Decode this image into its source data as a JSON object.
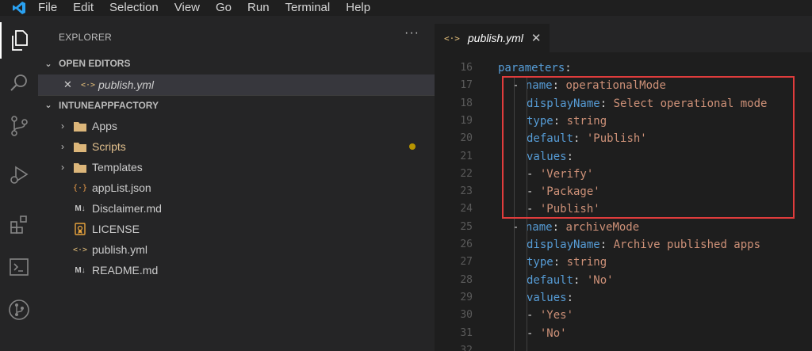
{
  "menu": [
    "File",
    "Edit",
    "Selection",
    "View",
    "Go",
    "Run",
    "Terminal",
    "Help"
  ],
  "activity_bar": [
    {
      "name": "explorer-icon",
      "active": true
    },
    {
      "name": "search-icon",
      "active": false
    },
    {
      "name": "source-control-icon",
      "active": false
    },
    {
      "name": "run-debug-icon",
      "active": false
    },
    {
      "name": "extensions-icon",
      "active": false
    },
    {
      "name": "terminal-icon",
      "active": false
    },
    {
      "name": "git-icon",
      "active": false
    }
  ],
  "sidebar": {
    "title": "EXPLORER",
    "more": "···",
    "open_editors_label": "OPEN EDITORS",
    "open_editor_close": "✕",
    "open_editor_file": "publish.yml",
    "project_label": "INTUNEAPPFACTORY",
    "items": [
      {
        "label": "Apps",
        "type": "folder"
      },
      {
        "label": "Scripts",
        "type": "folder",
        "modified": true
      },
      {
        "label": "Templates",
        "type": "folder"
      },
      {
        "label": "appList.json",
        "type": "json"
      },
      {
        "label": "Disclaimer.md",
        "type": "md"
      },
      {
        "label": "LICENSE",
        "type": "license"
      },
      {
        "label": "publish.yml",
        "type": "yml"
      },
      {
        "label": "README.md",
        "type": "md"
      }
    ]
  },
  "editor": {
    "tab_label": "publish.yml",
    "tab_icon": "<·>",
    "tab_close": "✕",
    "line_numbers": [
      "16",
      "17",
      "18",
      "19",
      "20",
      "21",
      "22",
      "23",
      "24",
      "25",
      "26",
      "27",
      "28",
      "29",
      "30",
      "31",
      "32"
    ],
    "lines": [
      {
        "key": "parameters",
        "sep": ":",
        "val": ""
      },
      {
        "dash": "- ",
        "key": "name",
        "sep": ": ",
        "val": "operationalMode"
      },
      {
        "key": "displayName",
        "sep": ": ",
        "val": "Select operational mode"
      },
      {
        "key": "type",
        "sep": ": ",
        "val": "string"
      },
      {
        "key": "default",
        "sep": ": ",
        "val": "'Publish'"
      },
      {
        "key": "values",
        "sep": ":",
        "val": ""
      },
      {
        "dash": "- ",
        "val": "'Verify'"
      },
      {
        "dash": "- ",
        "val": "'Package'"
      },
      {
        "dash": "- ",
        "val": "'Publish'"
      },
      {
        "dash": "- ",
        "key": "name",
        "sep": ": ",
        "val": "archiveMode"
      },
      {
        "key": "displayName",
        "sep": ": ",
        "val": "Archive published apps"
      },
      {
        "key": "type",
        "sep": ": ",
        "val": "string"
      },
      {
        "key": "default",
        "sep": ": ",
        "val": "'No'"
      },
      {
        "key": "values",
        "sep": ":",
        "val": ""
      },
      {
        "dash": "- ",
        "val": "'Yes'"
      },
      {
        "dash": "- ",
        "val": "'No'"
      }
    ]
  },
  "colors": {
    "accent": "#007acc",
    "highlight": "#e03c3c",
    "key": "#569cd6",
    "string": "#ce9178"
  }
}
